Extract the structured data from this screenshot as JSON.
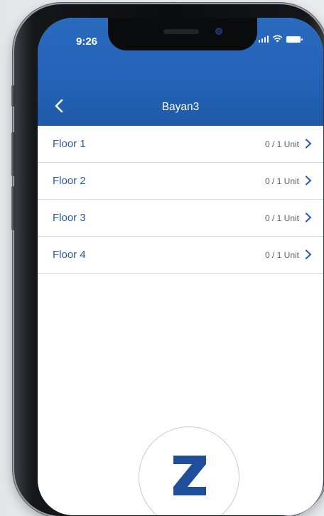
{
  "status_bar": {
    "time": "9:26"
  },
  "nav": {
    "title": "Bayan3",
    "back_icon": "chevron-left-icon"
  },
  "floors": [
    {
      "label": "Floor 1",
      "count": "0 / 1 Unit"
    },
    {
      "label": "Floor 2",
      "count": "0 / 1 Unit"
    },
    {
      "label": "Floor 3",
      "count": "0 / 1 Unit"
    },
    {
      "label": "Floor 4",
      "count": "0 / 1 Unit"
    }
  ],
  "colors": {
    "header_blue": "#2463b7",
    "row_text": "#2c5c9c",
    "chevron": "#2a64c0",
    "logo": "#1f4f9a"
  }
}
